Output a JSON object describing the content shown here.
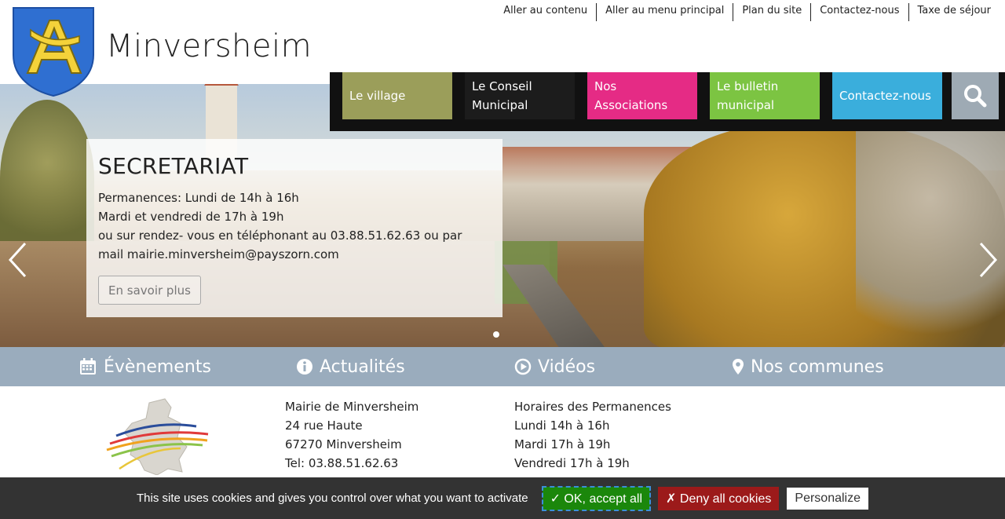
{
  "header": {
    "site_title": "Minversheim",
    "utility_links": [
      "Aller au contenu",
      "Aller au menu principal",
      "Plan du site",
      "Contactez-nous",
      "Taxe de séjour"
    ]
  },
  "nav": {
    "items": [
      "Le village",
      "Le Conseil Municipal",
      "Nos Associations",
      "Le bulletin municipal",
      "Contactez-nous"
    ],
    "search_icon": "search-icon"
  },
  "slide": {
    "title": "SECRETARIAT",
    "line1": "Permanences: Lundi de 14h à 16h",
    "line2": "Mardi et vendredi de 17h à 19h",
    "line3": "ou sur rendez- vous en téléphonant au 03.88.51.62.63 ou par",
    "line4": "mail mairie.minversheim@payszorn.com",
    "button": "En savoir plus"
  },
  "quicklinks": {
    "events": "Évènements",
    "news": "Actualités",
    "videos": "Vidéos",
    "communes": "Nos communes"
  },
  "footer": {
    "mairie": [
      "Mairie de Minversheim",
      "24 rue Haute",
      "67270 Minversheim",
      "Tel: 03.88.51.62.63"
    ],
    "horaires": [
      "Horaires des Permanences",
      "Lundi 14h à 16h",
      "Mardi 17h à 19h",
      "Vendredi 17h à 19h"
    ]
  },
  "cookie": {
    "text": "This site uses cookies and gives you control over what you want to activate",
    "ok": "✓ OK, accept all",
    "deny": "✗ Deny all cookies",
    "personalize": "Personalize"
  },
  "colors": {
    "village": "#9b9e5a",
    "conseil": "#1c1c1c",
    "associations": "#e52b85",
    "bulletin": "#7cc442",
    "contact": "#3aaedc",
    "quickbar": "#9aacbd"
  }
}
